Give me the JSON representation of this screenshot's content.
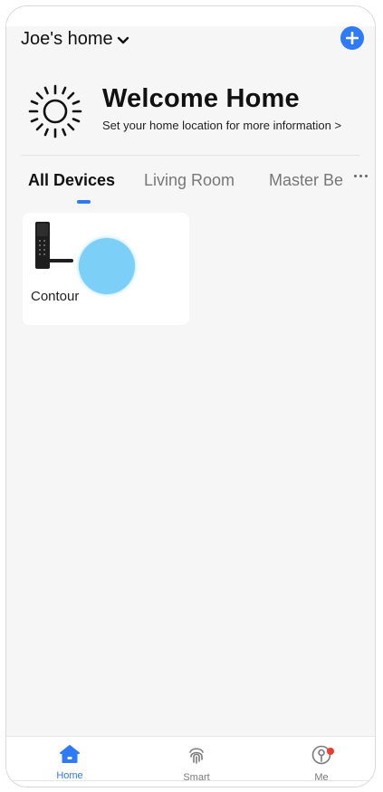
{
  "header": {
    "home_name": "Joe's home"
  },
  "welcome": {
    "title": "Welcome Home",
    "subtitle": "Set your home location for more information >"
  },
  "tabs": [
    {
      "label": "All Devices",
      "active": true
    },
    {
      "label": "Living Room",
      "active": false
    },
    {
      "label": "Master Be",
      "active": false
    }
  ],
  "devices": [
    {
      "name": "Contour",
      "icon": "smart-door-lock"
    }
  ],
  "bottom_nav": [
    {
      "label": "Home",
      "icon": "house-icon",
      "active": true
    },
    {
      "label": "Smart",
      "icon": "fingerprint-icon",
      "active": false
    },
    {
      "label": "Me",
      "icon": "person-icon",
      "active": false,
      "badge": true
    }
  ],
  "colors": {
    "accent": "#2f7af6",
    "badge": "#ee3a30",
    "background": "#f6f6f6"
  }
}
